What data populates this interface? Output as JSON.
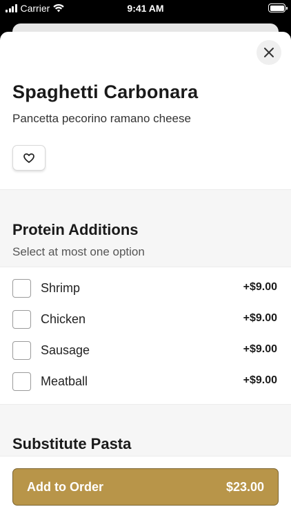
{
  "status_bar": {
    "carrier": "Carrier",
    "time": "9:41 AM",
    "icons": [
      "signal-icon",
      "wifi-icon",
      "battery-icon"
    ]
  },
  "item": {
    "title": "Spaghetti Carbonara",
    "description": "Pancetta pecorino ramano cheese",
    "favorite_icon": "heart-icon",
    "close_icon": "close-icon"
  },
  "groups": [
    {
      "title": "Protein Additions",
      "subtitle": "Select at most one option",
      "options": [
        {
          "name": "Shrimp",
          "price": "+$9.00",
          "checked": false
        },
        {
          "name": "Chicken",
          "price": "+$9.00",
          "checked": false
        },
        {
          "name": "Sausage",
          "price": "+$9.00",
          "checked": false
        },
        {
          "name": "Meatball",
          "price": "+$9.00",
          "checked": false
        }
      ]
    },
    {
      "title": "Substitute Pasta"
    }
  ],
  "footer": {
    "button_label": "Add to Order",
    "button_price": "$23.00"
  },
  "colors": {
    "accent": "#b89549",
    "section_bg": "#f6f6f6"
  }
}
